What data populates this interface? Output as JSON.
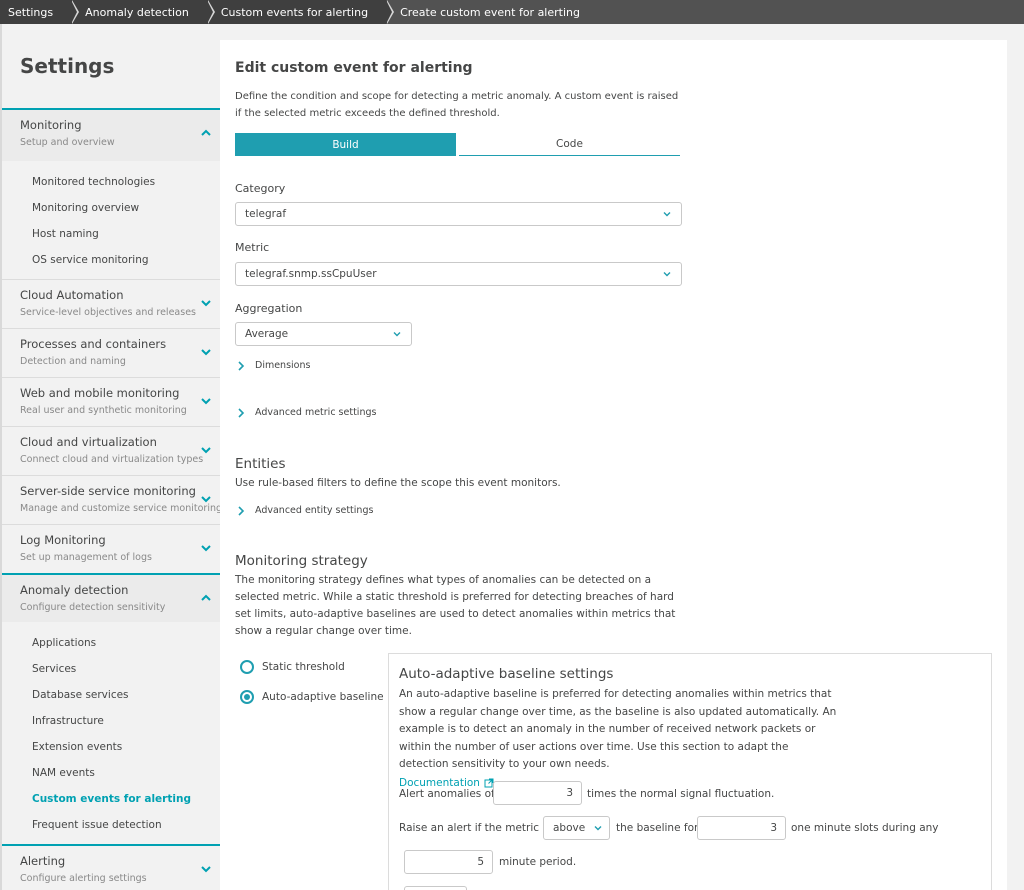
{
  "breadcrumb": [
    "Settings",
    "Anomaly detection",
    "Custom events for alerting",
    "Create custom event for alerting"
  ],
  "sidebar": {
    "title": "Settings",
    "sections": [
      {
        "title": "Monitoring",
        "subtitle": "Setup and overview",
        "open": true,
        "items": [
          "Monitored technologies",
          "Monitoring overview",
          "Host naming",
          "OS service monitoring"
        ]
      },
      {
        "title": "Cloud Automation",
        "subtitle": "Service-level objectives and releases"
      },
      {
        "title": "Processes and containers",
        "subtitle": "Detection and naming"
      },
      {
        "title": "Web and mobile monitoring",
        "subtitle": "Real user and synthetic monitoring"
      },
      {
        "title": "Cloud and virtualization",
        "subtitle": "Connect cloud and virtualization types"
      },
      {
        "title": "Server-side service monitoring",
        "subtitle": "Manage and customize service monitoring"
      },
      {
        "title": "Log Monitoring",
        "subtitle": "Set up management of logs"
      },
      {
        "title": "Anomaly detection",
        "subtitle": "Configure detection sensitivity",
        "open": true,
        "items": [
          "Applications",
          "Services",
          "Database services",
          "Infrastructure",
          "Extension events",
          "NAM events",
          "Custom events for alerting",
          "Frequent issue detection"
        ],
        "active_item": "Custom events for alerting"
      },
      {
        "title": "Alerting",
        "subtitle": "Configure alerting settings"
      }
    ]
  },
  "main": {
    "title": "Edit custom event for alerting",
    "description": "Define the condition and scope for detecting a metric anomaly. A custom event is raised if the selected metric exceeds the defined threshold.",
    "tabs": [
      "Build",
      "Code"
    ],
    "category_label": "Category",
    "category_value": "telegraf",
    "metric_label": "Metric",
    "metric_value": "telegraf.snmp.ssCpuUser",
    "aggregation_label": "Aggregation",
    "aggregation_value": "Average",
    "dimensions_label": "Dimensions",
    "advanced_metric_label": "Advanced metric settings",
    "entities_title": "Entities",
    "entities_desc": "Use rule-based filters to define the scope this event monitors.",
    "advanced_entity_label": "Advanced entity settings",
    "strategy_title": "Monitoring strategy",
    "strategy_desc": "The monitoring strategy defines what types of anomalies can be detected on a selected metric. While a static threshold is preferred for detecting breaches of hard set limits, auto-adaptive baselines are used to detect anomalies within metrics that show a regular change over time.",
    "radio_static": "Static threshold",
    "radio_adaptive": "Auto-adaptive baseline",
    "panel": {
      "title": "Auto-adaptive baseline settings",
      "desc": "An auto-adaptive baseline is preferred for detecting anomalies within metrics that show a regular change over time, as the baseline is also updated automatically. An example is to detect an anomaly in the number of received network packets or within the number of user actions over time. Use this section to adapt the detection sensitivity to your own needs.",
      "doc_link": "Documentation",
      "alert_prefix": "Alert anomalies of",
      "alert_value": "3",
      "alert_suffix": "times the normal signal fluctuation.",
      "raise_prefix": "Raise an alert if the metric is",
      "raise_select": "above",
      "raise_mid": "the baseline for",
      "raise_value": "3",
      "raise_suffix": "one minute slots during any",
      "period_value": "5",
      "period_suffix": "minute period."
    }
  },
  "colors": {
    "accent": "#1f9eb0",
    "breadcrumb_bg": "#3f3f3f"
  }
}
